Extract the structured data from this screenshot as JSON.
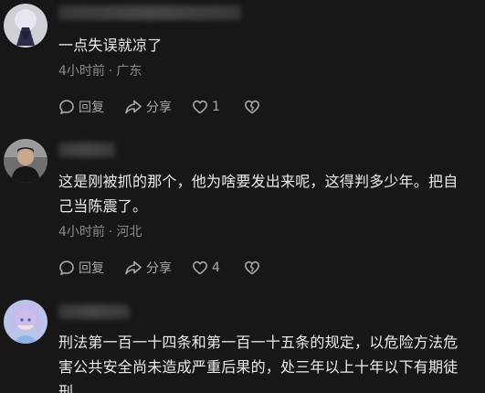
{
  "comments": [
    {
      "text": "一点失误就凉了",
      "time": "4小时前",
      "location": "广东",
      "reply_label": "回复",
      "share_label": "分享",
      "like_count": "1"
    },
    {
      "text": "这是刚被抓的那个，他为啥要发出来呢，这得判多少年。把自己当陈震了。",
      "time": "4小时前",
      "location": "河北",
      "reply_label": "回复",
      "share_label": "分享",
      "like_count": "4"
    },
    {
      "text": "刑法第一百一十四条和第一百一十五条的规定，以危险方法危害公共安全尚未造成严重后果的，处三年以上十年以下有期徒刑"
    }
  ],
  "meta_separator": "·",
  "icons": {
    "reply": "speech-bubble-icon",
    "share": "share-arrow-icon",
    "like": "heart-icon",
    "dislike": "broken-heart-icon"
  },
  "colors": {
    "background": "#171717",
    "text": "#ececec",
    "meta": "#8a8a8a",
    "action": "#a8a8a8"
  }
}
